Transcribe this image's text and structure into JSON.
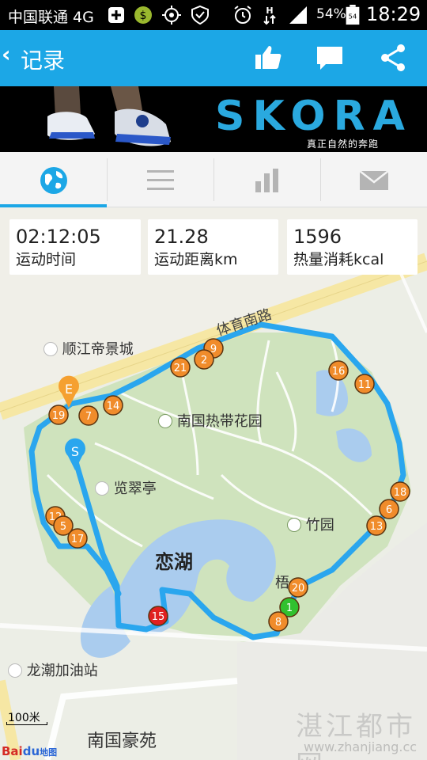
{
  "status_bar": {
    "carrier": "中国联通 4G",
    "battery_percent": "54%",
    "battery_level": "54",
    "time": "18:29"
  },
  "header": {
    "back_icon": "chevron-left-icon",
    "title": "记录",
    "actions": [
      "thumbs-up-icon",
      "chat-icon",
      "share-icon"
    ]
  },
  "banner": {
    "brand": "SKORA",
    "slogan": "真正自然的奔跑"
  },
  "tabs": [
    {
      "icon": "globe-icon",
      "active": true
    },
    {
      "icon": "list-icon",
      "active": false
    },
    {
      "icon": "bar-chart-icon",
      "active": false
    },
    {
      "icon": "mail-icon",
      "active": false
    }
  ],
  "stats": [
    {
      "value": "02:12:05",
      "label": "运动时间"
    },
    {
      "value": "21.28",
      "label": "运动距离km"
    },
    {
      "value": "1596",
      "label": "热量消耗kcal"
    }
  ],
  "map": {
    "road_label": "体育南路",
    "pois": [
      "顺江帝景城",
      "南国热带花园",
      "览翠亭",
      "竹园",
      "恋湖",
      "梧",
      "龙潮加油站",
      "南国豪苑"
    ],
    "start_marker": "S",
    "end_marker": "E",
    "km_markers": [
      "9",
      "2",
      "21",
      "16",
      "11",
      "14",
      "7",
      "19",
      "18",
      "6",
      "13",
      "12",
      "5",
      "17",
      "20",
      "1",
      "8",
      "15"
    ],
    "scale": "100米",
    "map_provider": {
      "bai": "Bai",
      "du": "du",
      "suffix": "地图"
    }
  },
  "watermark": {
    "text": "湛江都市网",
    "url": "www.zhanjiang.cc"
  },
  "colors": {
    "accent": "#1ca7e6",
    "route": "#2aa6ee",
    "km_marker": "#f08c2b",
    "start_marker": "#2aa6ee",
    "end_marker": "#f5a030",
    "first_km": "#31c12f",
    "last_km": "#e02020"
  }
}
